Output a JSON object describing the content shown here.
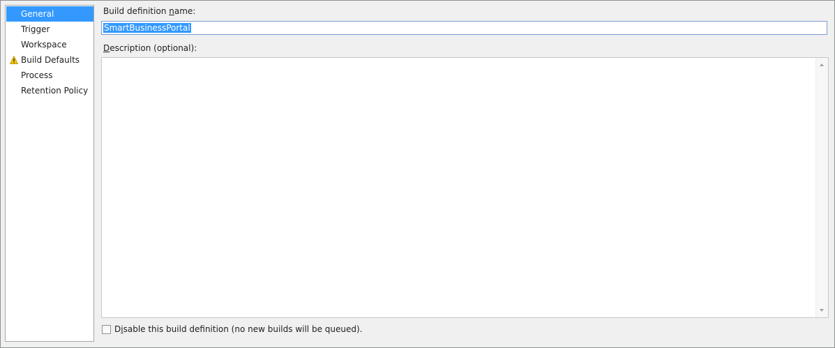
{
  "sidebar": {
    "items": [
      {
        "label": "General",
        "selected": true,
        "warning": false
      },
      {
        "label": "Trigger",
        "selected": false,
        "warning": false
      },
      {
        "label": "Workspace",
        "selected": false,
        "warning": false
      },
      {
        "label": "Build Defaults",
        "selected": false,
        "warning": true
      },
      {
        "label": "Process",
        "selected": false,
        "warning": false
      },
      {
        "label": "Retention Policy",
        "selected": false,
        "warning": false
      }
    ]
  },
  "form": {
    "name_label_pre": "Build definition ",
    "name_label_access": "n",
    "name_label_post": "ame:",
    "name_value": "SmartBusinessPortal",
    "desc_label_access": "D",
    "desc_label_post": "escription (optional):",
    "desc_value": "",
    "disable_checked": false,
    "disable_label_pre": "D",
    "disable_label_access": "i",
    "disable_label_post": "sable this build definition (no new builds will be queued)."
  },
  "colors": {
    "selection": "#3399ff",
    "warning": "#f5c400"
  }
}
